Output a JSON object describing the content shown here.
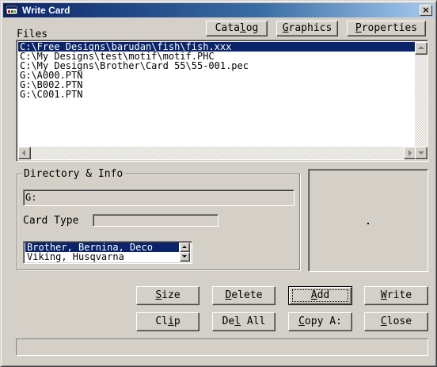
{
  "window": {
    "title": "Write Card",
    "close_glyph": "×",
    "icon": "card-writer-icon"
  },
  "toolbar": {
    "catalog": {
      "pre": "Cata",
      "u": "l",
      "post": "og"
    },
    "graphics": {
      "pre": "",
      "u": "G",
      "post": "raphics"
    },
    "properties": {
      "pre": "",
      "u": "P",
      "post": "roperties"
    }
  },
  "files": {
    "label": "Files",
    "items": [
      "C:\\Free Designs\\barudan\\fish\\fish.xxx",
      "C:\\My Designs\\test\\motif\\motif.PHC",
      "C:\\My Designs\\Brother\\Card 55\\55-001.pec",
      "G:\\A000.PTN",
      "G:\\B002.PTN",
      "G:\\C001.PTN"
    ],
    "selected_index": 0
  },
  "directory_info": {
    "group_title": "Directory & Info",
    "path_value": "G:",
    "card_type_label": "Card Type",
    "card_type_value": "",
    "formats": [
      "Brother, Bernina, Deco",
      "Viking, Husqvarna"
    ],
    "selected_format_index": 0
  },
  "buttons": {
    "size": {
      "pre": "",
      "u": "S",
      "post": "ize"
    },
    "delete": {
      "pre": "",
      "u": "D",
      "post": "elete"
    },
    "add": {
      "pre": "",
      "u": "A",
      "post": "dd"
    },
    "write": {
      "pre": "",
      "u": "W",
      "post": "rite"
    },
    "clip": {
      "pre": "Cl",
      "u": "i",
      "post": "p"
    },
    "del_all": {
      "pre": "De",
      "u": "l",
      "post": " All"
    },
    "copy": {
      "pre": "",
      "u": "C",
      "post": "opy A:"
    },
    "close": {
      "pre": "",
      "u": "C",
      "post": "lose"
    }
  },
  "status": {
    "text": ""
  },
  "colors": {
    "face": "#d4d0c8",
    "title_start": "#0a246a",
    "title_end": "#a6caf0",
    "selection": "#0a246a"
  }
}
